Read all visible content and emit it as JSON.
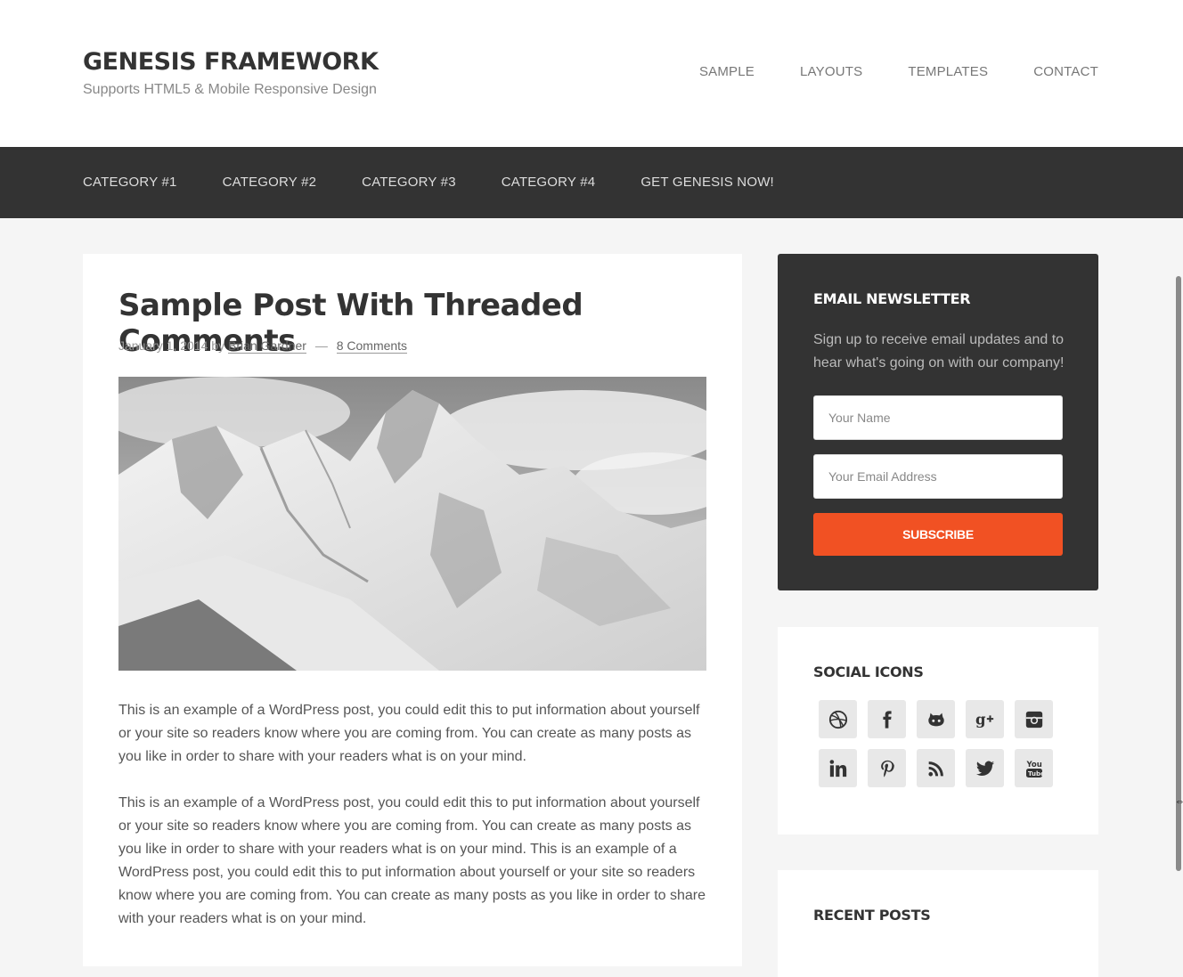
{
  "site": {
    "title": "GENESIS FRAMEWORK",
    "description": "Supports HTML5 & Mobile Responsive Design"
  },
  "header_nav": [
    "SAMPLE",
    "LAYOUTS",
    "TEMPLATES",
    "CONTACT"
  ],
  "secondary_nav": [
    "CATEGORY #1",
    "CATEGORY #2",
    "CATEGORY #3",
    "CATEGORY #4",
    "GET GENESIS NOW!"
  ],
  "post": {
    "title": "Sample Post With Threaded Comments",
    "date": "January 1, 2014",
    "by": "by",
    "author": "Brian Gardner",
    "separator": "—",
    "comments": "8 Comments",
    "paragraphs": [
      "This is an example of a WordPress post, you could edit this to put information about yourself or your site so readers know where you are coming from. You can create as many posts as you like in order to share with your readers what is on your mind.",
      "This is an example of a WordPress post, you could edit this to put information about yourself or your site so readers know where you are coming from. You can create as many posts as you like in order to share with your readers what is on your mind. This is an example of a WordPress post, you could edit this to put information about yourself or your site so readers know where you are coming from. You can create as many posts as you like in order to share with your readers what is on your mind."
    ]
  },
  "newsletter": {
    "title": "EMAIL NEWSLETTER",
    "description": "Sign up to receive email updates and to hear what's going on with our company!",
    "name_placeholder": "Your Name",
    "email_placeholder": "Your Email Address",
    "button": "SUBSCRIBE",
    "accent_color": "#f15123"
  },
  "social": {
    "title": "SOCIAL ICONS",
    "icons": [
      "dribbble-icon",
      "facebook-icon",
      "github-icon",
      "google-plus-icon",
      "instagram-icon",
      "linkedin-icon",
      "pinterest-icon",
      "rss-icon",
      "twitter-icon",
      "youtube-icon"
    ]
  },
  "recent_posts": {
    "title": "RECENT POSTS"
  }
}
